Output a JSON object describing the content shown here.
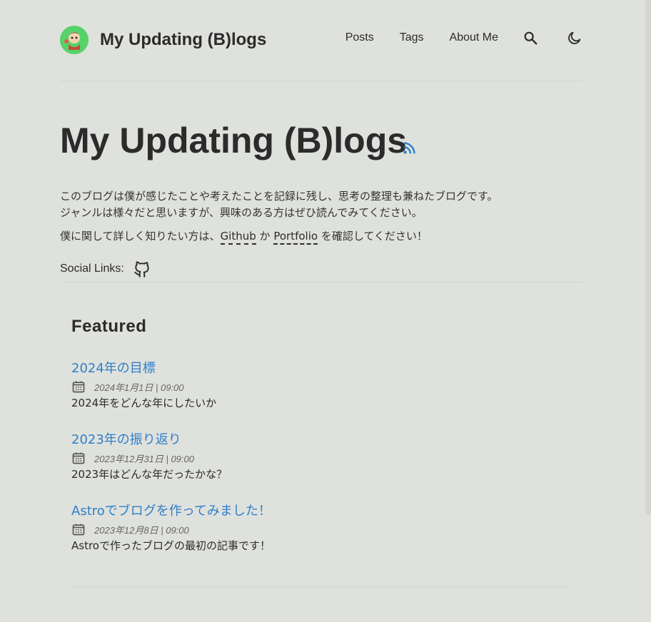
{
  "site": {
    "brand": "My Updating (B)logs",
    "nav": [
      "Posts",
      "Tags",
      "About Me"
    ]
  },
  "hero": {
    "title": "My Updating (B)logs",
    "intro_line1": "このブログは僕が感じたことや考えたことを記録に残し、思考の整理も兼ねたブログです。",
    "intro_line2": "ジャンルは様々だと思いますが、興味のある方はぜひ読んでみてください。",
    "intro_more_prefix": "僕に関して詳しく知りたい方は、",
    "link_github": "Github",
    "connector": " か ",
    "link_portfolio": "Portfolio",
    "intro_more_suffix": " を確認してください！",
    "social_label": "Social Links:"
  },
  "featured": {
    "heading": "Featured",
    "posts": [
      {
        "title": "2024年の目標",
        "date": "2024年1月1日 | 09:00",
        "desc": "2024年をどんな年にしたいか"
      },
      {
        "title": "2023年の振り返り",
        "date": "2023年12月31日 | 09:00",
        "desc": "2023年はどんな年だったかな？"
      },
      {
        "title": "Astroでブログを作ってみました！",
        "date": "2023年12月8日 | 09:00",
        "desc": "Astroで作ったブログの最初の記事です！"
      }
    ]
  },
  "icons": {
    "search": "search-icon",
    "theme": "moon-icon",
    "rss": "rss-icon",
    "github": "github-icon",
    "calendar": "calendar-icon"
  },
  "colors": {
    "background": "#dfe1dd",
    "link": "#2f7fc8",
    "avatar_bg": "#56d26a"
  }
}
